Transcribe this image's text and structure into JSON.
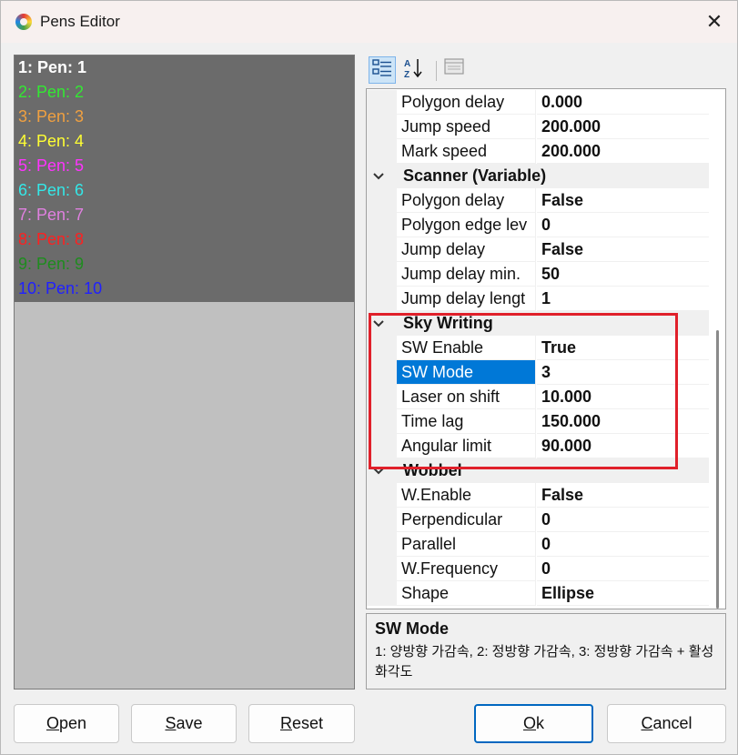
{
  "window": {
    "title": "Pens Editor"
  },
  "pens": [
    {
      "label": "1: Pen: 1",
      "color": "#ffffff"
    },
    {
      "label": "2: Pen: 2",
      "color": "#33e833"
    },
    {
      "label": "3: Pen: 3",
      "color": "#f0a040"
    },
    {
      "label": "4: Pen: 4",
      "color": "#ffff33"
    },
    {
      "label": "5: Pen: 5",
      "color": "#ff33ff"
    },
    {
      "label": "6: Pen: 6",
      "color": "#33e8e8"
    },
    {
      "label": "7: Pen: 7",
      "color": "#e080e0"
    },
    {
      "label": "8: Pen: 8",
      "color": "#ff2020"
    },
    {
      "label": "9: Pen: 9",
      "color": "#1e8c1e"
    },
    {
      "label": "10: Pen: 10",
      "color": "#2020ff"
    }
  ],
  "toolbar": {
    "categorized_icon": "categorized-icon",
    "alphabetical_icon": "sort-az-icon",
    "pages_icon": "property-pages-icon"
  },
  "properties": [
    {
      "kind": "prop",
      "name": "Polygon delay",
      "value": "0.000"
    },
    {
      "kind": "prop",
      "name": "Jump speed",
      "value": "200.000"
    },
    {
      "kind": "prop",
      "name": "Mark speed",
      "value": "200.000"
    },
    {
      "kind": "category",
      "name": "Scanner (Variable)"
    },
    {
      "kind": "prop",
      "name": "Polygon delay",
      "value": "False"
    },
    {
      "kind": "prop",
      "name": "Polygon edge lev",
      "value": "0"
    },
    {
      "kind": "prop",
      "name": "Jump delay",
      "value": "False"
    },
    {
      "kind": "prop",
      "name": "Jump delay min.",
      "value": "50"
    },
    {
      "kind": "prop",
      "name": "Jump delay lengt",
      "value": "1"
    },
    {
      "kind": "category",
      "name": "Sky Writing"
    },
    {
      "kind": "prop",
      "name": "SW Enable",
      "value": "True"
    },
    {
      "kind": "prop",
      "name": "SW Mode",
      "value": "3",
      "selected": true
    },
    {
      "kind": "prop",
      "name": "Laser on shift",
      "value": "10.000"
    },
    {
      "kind": "prop",
      "name": "Time lag",
      "value": "150.000"
    },
    {
      "kind": "prop",
      "name": "Angular limit",
      "value": "90.000"
    },
    {
      "kind": "category",
      "name": "Wobbel"
    },
    {
      "kind": "prop",
      "name": "W.Enable",
      "value": "False"
    },
    {
      "kind": "prop",
      "name": "Perpendicular",
      "value": "0"
    },
    {
      "kind": "prop",
      "name": "Parallel",
      "value": "0"
    },
    {
      "kind": "prop",
      "name": "W.Frequency",
      "value": "0"
    },
    {
      "kind": "prop",
      "name": "Shape",
      "value": "Ellipse"
    }
  ],
  "description": {
    "title": "SW Mode",
    "text": "1: 양방향 가감속, 2: 정방향 가감속, 3: 정방향 가감속 + 활성화각도"
  },
  "buttons": {
    "open": "Open",
    "save": "Save",
    "reset": "Reset",
    "ok": "Ok",
    "cancel": "Cancel"
  },
  "colors": {
    "accent": "#0078d7",
    "highlight": "#e0202a"
  }
}
